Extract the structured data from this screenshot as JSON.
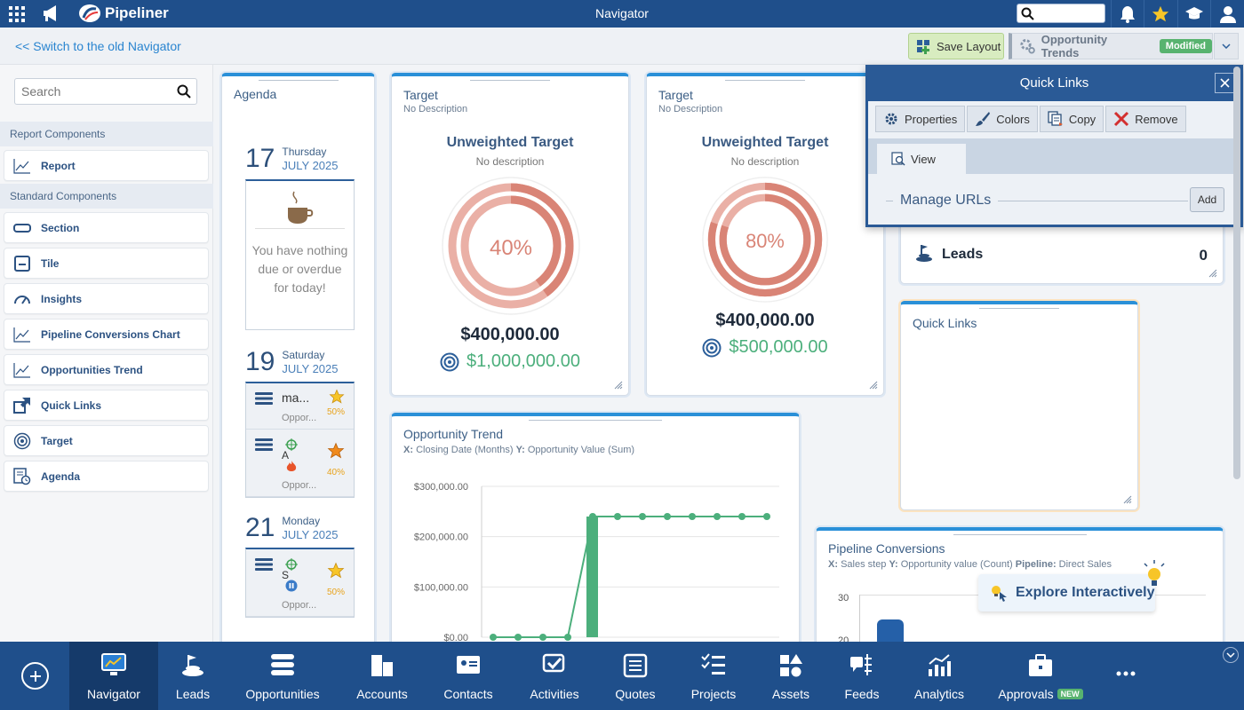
{
  "topbar": {
    "app_name": "Pipeliner",
    "title": "Navigator",
    "search_placeholder": ""
  },
  "subbar": {
    "old_navigator": "<< Switch to the old Navigator",
    "save_layout": "Save Layout",
    "layout_name": "Opportunity Trends",
    "layout_status": "Modified"
  },
  "sidebar": {
    "search_placeholder": "Search",
    "report_section": "Report Components",
    "standard_section": "Standard Components",
    "items": [
      {
        "label": "Report",
        "icon": "line-chart-icon"
      },
      {
        "label": "Section",
        "icon": "section-icon"
      },
      {
        "label": "Tile",
        "icon": "tile-icon"
      },
      {
        "label": "Insights",
        "icon": "gauge-icon"
      },
      {
        "label": "Pipeline Conversions Chart",
        "icon": "line-chart-icon"
      },
      {
        "label": "Opportunities Trend",
        "icon": "line-chart-icon"
      },
      {
        "label": "Quick Links",
        "icon": "external-link-icon"
      },
      {
        "label": "Target",
        "icon": "target-icon"
      },
      {
        "label": "Agenda",
        "icon": "agenda-icon"
      }
    ]
  },
  "agenda": {
    "title": "Agenda",
    "days": [
      {
        "day": "17",
        "weekday": "Thursday",
        "month": "JULY 2025",
        "empty_message": "You have nothing due or overdue for today!"
      },
      {
        "day": "19",
        "weekday": "Saturday",
        "month": "JULY 2025",
        "rows": [
          {
            "title": "ma...",
            "sub": "Oppor...",
            "pct": "50%"
          },
          {
            "title": "A",
            "sub": "Oppor...",
            "pct": "40%"
          }
        ]
      },
      {
        "day": "21",
        "weekday": "Monday",
        "month": "JULY 2025",
        "rows": [
          {
            "title": "S",
            "sub": "Oppor...",
            "pct": "50%"
          }
        ]
      }
    ]
  },
  "targets": [
    {
      "title": "Target",
      "desc": "No Description",
      "heading": "Unweighted Target",
      "nodesc": "No description",
      "percent": "40%",
      "progress": 0.4,
      "amount": "$400,000.00",
      "goal": "$1,000,000.00"
    },
    {
      "title": "Target",
      "desc": "No Description",
      "heading": "Unweighted Target",
      "nodesc": "No description",
      "percent": "80%",
      "progress": 0.8,
      "amount": "$400,000.00",
      "goal": "$500,000.00"
    }
  ],
  "leads_tile": {
    "label": "Leads",
    "count": "0"
  },
  "quick_links_card": {
    "title": "Quick Links"
  },
  "quick_links_panel": {
    "title": "Quick Links",
    "buttons": [
      "Properties",
      "Colors",
      "Copy",
      "Remove"
    ],
    "tab": "View",
    "manage": "Manage URLs",
    "add": "Add"
  },
  "opp_trend": {
    "title": "Opportunity Trend",
    "x_label_key": "X:",
    "x_label": "Closing Date (Months)",
    "y_label_key": "Y:",
    "y_label": "Opportunity Value (Sum)"
  },
  "pipeline": {
    "title": "Pipeline Conversions",
    "x_key": "X:",
    "x_val": "Sales step",
    "y_key": "Y:",
    "y_val": "Opportunity value (Count)",
    "p_key": "Pipeline:",
    "p_val": "Direct Sales",
    "tick_30": "30",
    "tick_20": "20"
  },
  "explore": "Explore Interactively",
  "chart_data": {
    "type": "line",
    "y_ticks": [
      "$300,000.00",
      "$200,000.00",
      "$100,000.00",
      "$0.00"
    ],
    "ylim": [
      0,
      300000
    ],
    "line_values": [
      0,
      0,
      0,
      0,
      240000,
      240000,
      240000,
      240000,
      240000,
      240000,
      240000,
      240000
    ],
    "bar": {
      "index": 4,
      "value": 240000
    }
  },
  "bottomnav": {
    "items": [
      {
        "label": "Navigator",
        "active": true
      },
      {
        "label": "Leads"
      },
      {
        "label": "Opportunities"
      },
      {
        "label": "Accounts"
      },
      {
        "label": "Contacts"
      },
      {
        "label": "Activities"
      },
      {
        "label": "Quotes"
      },
      {
        "label": "Projects"
      },
      {
        "label": "Assets"
      },
      {
        "label": "Feeds"
      },
      {
        "label": "Analytics"
      },
      {
        "label": "Approvals"
      }
    ],
    "new_badge": "NEW"
  },
  "colors": {
    "primary": "#1f4f8b",
    "accent": "#2a90d8",
    "target_ring": "#d98476",
    "goal_green": "#4caf7c",
    "chart_green": "#4caf7c"
  }
}
